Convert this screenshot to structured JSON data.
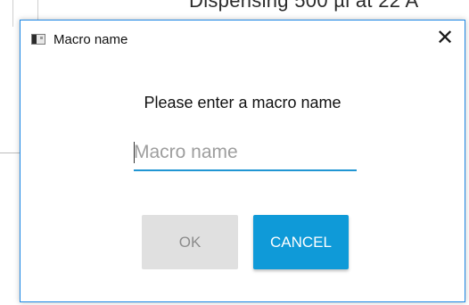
{
  "background": {
    "partial_text": "Dispensing 500 µl at 22 A"
  },
  "dialog": {
    "title": "Macro name",
    "close_glyph": "✕",
    "prompt": "Please enter a macro name",
    "input": {
      "value": "",
      "placeholder": "Macro name"
    },
    "buttons": {
      "ok_label": "OK",
      "cancel_label": "CANCEL"
    }
  },
  "colors": {
    "accent": "#0f9ad8",
    "border": "#1e88e5",
    "disabled_button": "#e0e0e0"
  },
  "icons": {
    "title_icon": "app-window-icon",
    "close_icon": "close-icon"
  }
}
